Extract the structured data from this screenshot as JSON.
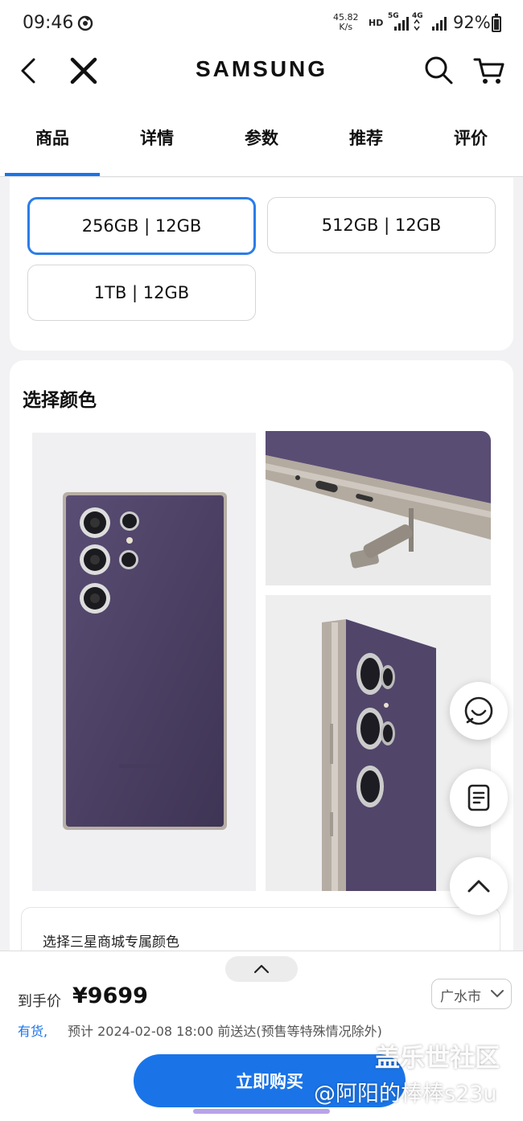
{
  "status_bar": {
    "time": "09:46",
    "speed_value": "45.82",
    "speed_unit": "K/s",
    "hd": "HD",
    "network_1": "5G",
    "network_2": "4G",
    "battery": "92%"
  },
  "header": {
    "brand": "SAMSUNG"
  },
  "tabs": [
    {
      "label": "商品"
    },
    {
      "label": "详情"
    },
    {
      "label": "参数"
    },
    {
      "label": "推荐"
    },
    {
      "label": "评价"
    }
  ],
  "storage_options": [
    {
      "label": "256GB | 12GB",
      "selected": true
    },
    {
      "label": "512GB | 12GB",
      "selected": false
    },
    {
      "label": "1TB | 12GB",
      "selected": false
    }
  ],
  "color_section": {
    "title": "选择颜色",
    "exclusive_label": "选择三星商城专属颜色"
  },
  "purchase": {
    "price_label": "到手价",
    "price": "¥9699",
    "region": "广水市",
    "stock_status": "有货,",
    "delivery": "预计 2024-02-08 18:00 前送达(预售等特殊情况除外)",
    "buy_label": "立即购买"
  },
  "watermark": {
    "line1": "盖乐世社区",
    "line2": "@阿阳的棒棒s23u"
  },
  "colors": {
    "accent": "#1a73e8",
    "selected_border": "#2b7de9",
    "phone_body": "#4e4265"
  }
}
